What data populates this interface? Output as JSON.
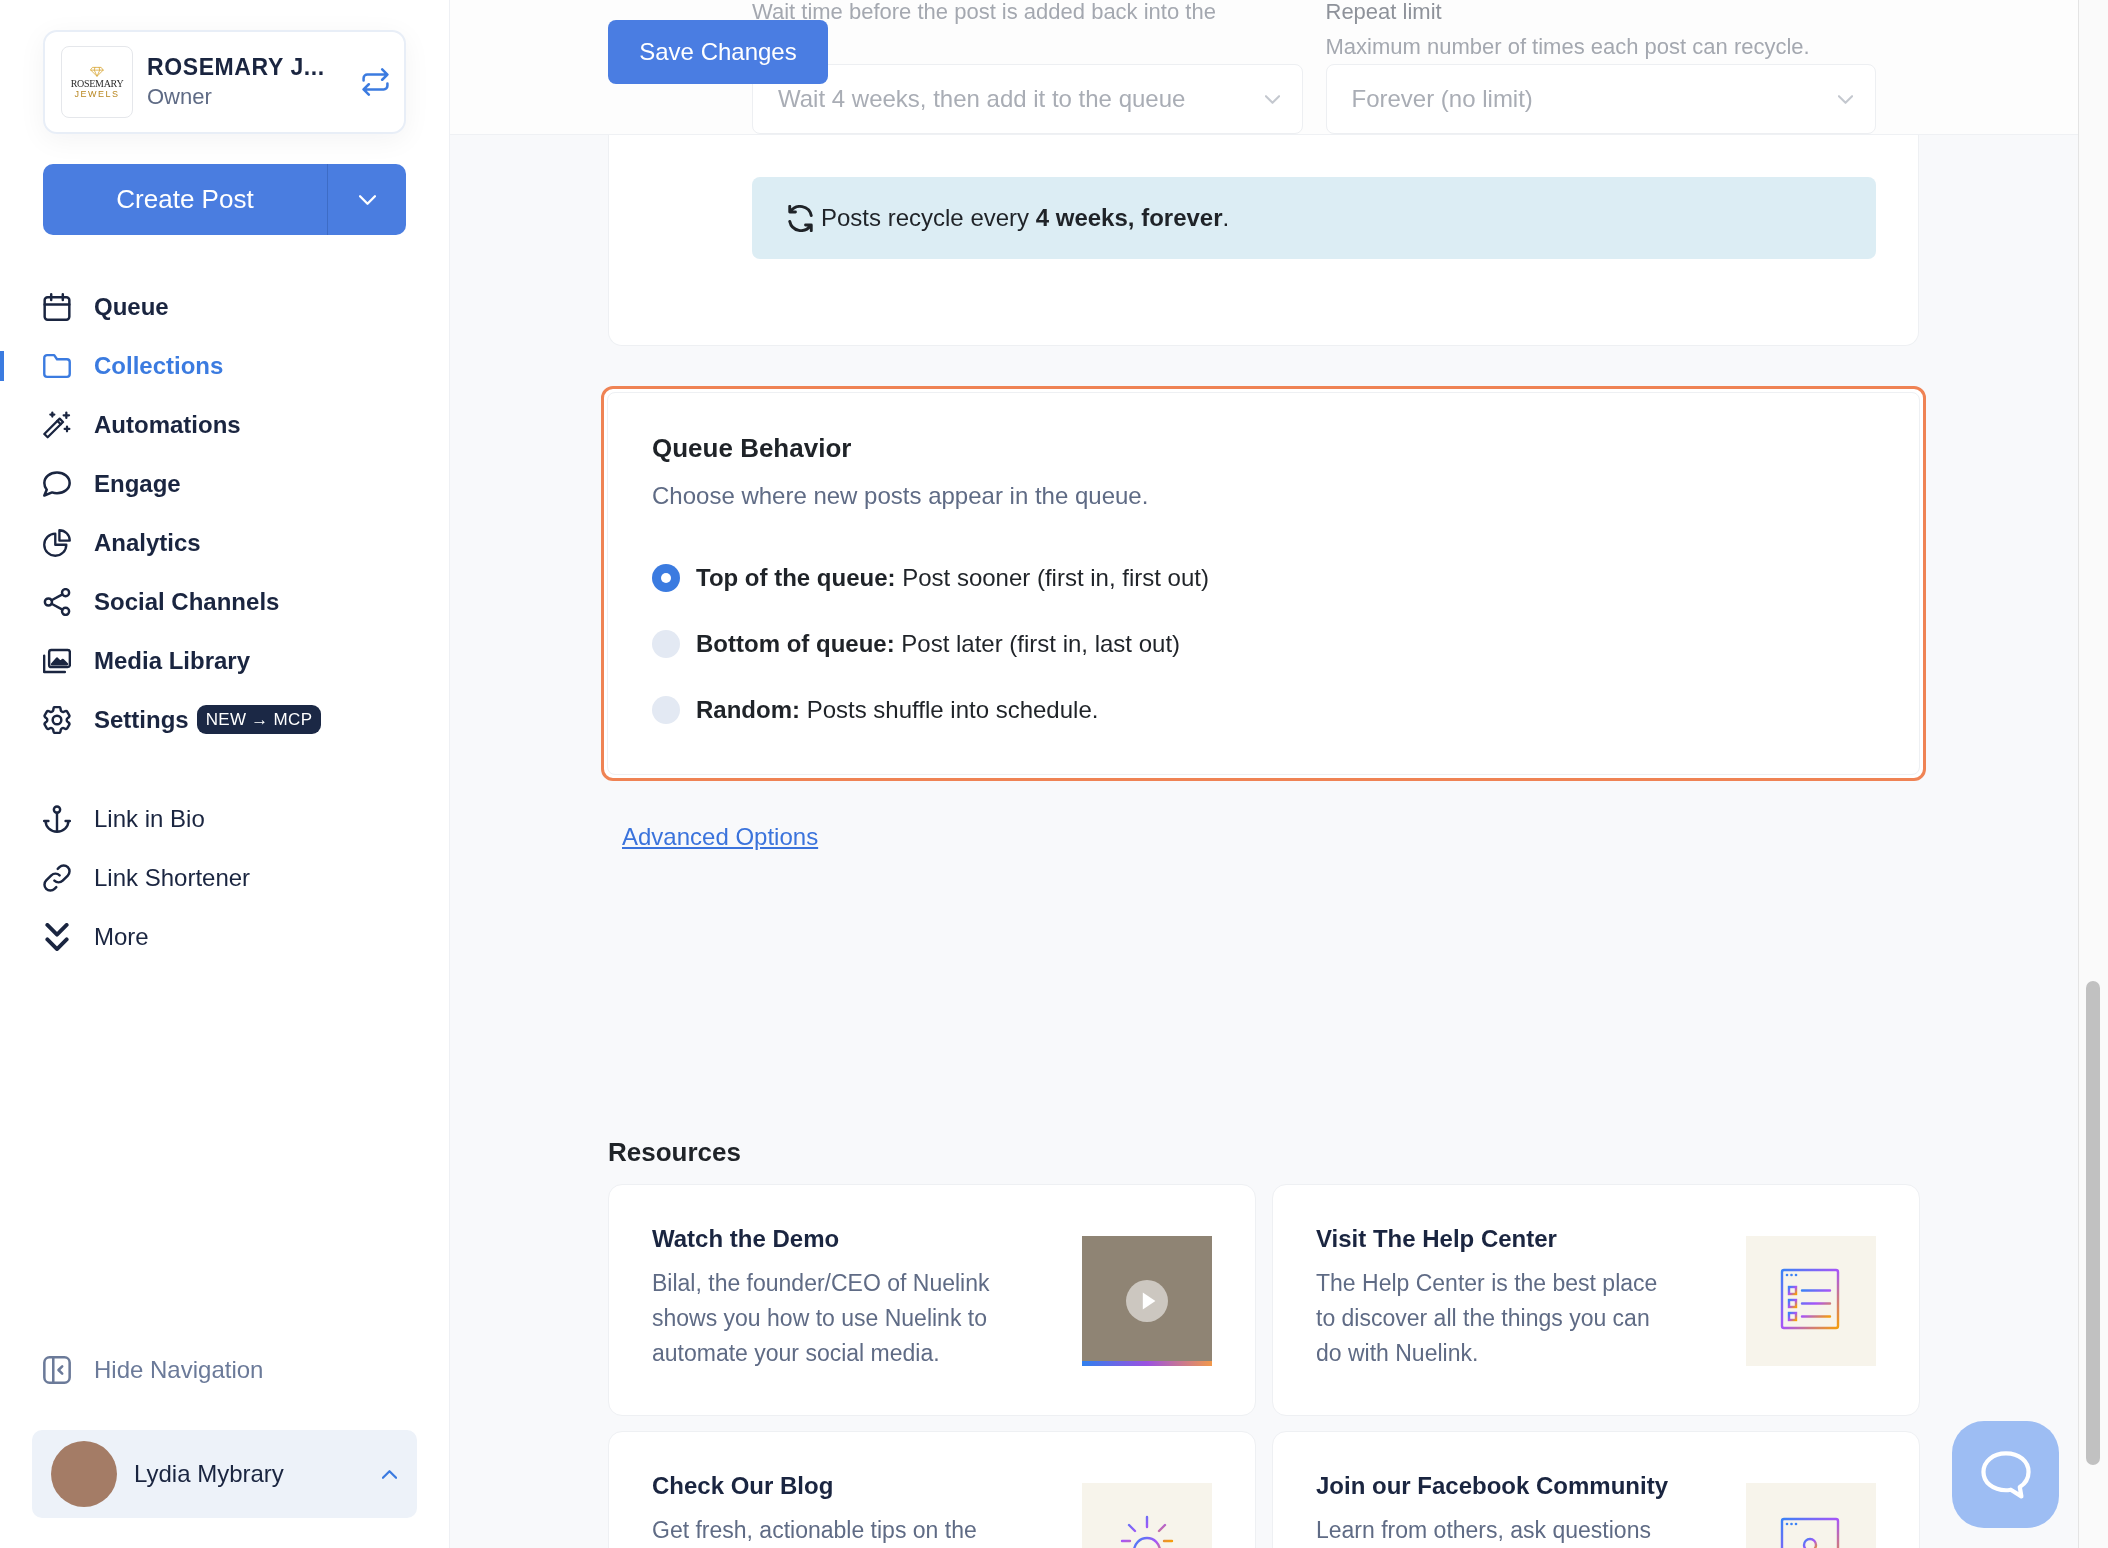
{
  "sidebar": {
    "account": {
      "logo_name": "ROSEMARY",
      "logo_tagline": "JEWELS",
      "name": "ROSEMARY J...",
      "role": "Owner"
    },
    "create_post": "Create Post",
    "nav": [
      {
        "label": "Queue",
        "selected": false
      },
      {
        "label": "Collections",
        "selected": true
      },
      {
        "label": "Automations",
        "selected": false
      },
      {
        "label": "Engage",
        "selected": false
      },
      {
        "label": "Analytics",
        "selected": false
      },
      {
        "label": "Social Channels",
        "selected": false
      },
      {
        "label": "Media Library",
        "selected": false
      },
      {
        "label": "Settings",
        "selected": false,
        "badge": "NEW → MCP"
      }
    ],
    "tools": [
      {
        "label": "Link in Bio",
        "selected": false
      },
      {
        "label": "Link Shortener",
        "selected": false
      },
      {
        "label": "More",
        "selected": false
      }
    ],
    "hide_navigation": "Hide Navigation",
    "user": {
      "name": "Lydia Mybrary"
    }
  },
  "header": {
    "save_button": "Save Changes"
  },
  "recycle_settings": {
    "fields": [
      {
        "hint": "Wait time before the post is added back into the",
        "value": "Wait 4 weeks, then add it to the queue"
      },
      {
        "label": "Repeat limit",
        "hint": "Maximum number of times each post can recycle.",
        "value": "Forever (no limit)"
      }
    ],
    "summary": "Posts recycle every **4 weeks, forever**."
  },
  "queue_behavior": {
    "title": "Queue Behavior",
    "subtitle": "Choose where new posts appear in the queue.",
    "options": [
      {
        "text": "**Top of the queue:** Post sooner (first in, first out)",
        "selected": true
      },
      {
        "text": "**Bottom of queue:** Post later (first in, last out)",
        "selected": false
      },
      {
        "text": "**Random:** Posts shuffle into schedule.",
        "selected": false
      }
    ]
  },
  "advanced_options": "Advanced Options",
  "resources": {
    "title": "Resources",
    "cards": [
      {
        "kind": "video",
        "title": "Watch the Demo",
        "description": "Bilal, the founder/CEO of Nuelink shows you how to use Nuelink to automate your social media."
      },
      {
        "kind": "checklist",
        "title": "Visit The Help Center",
        "description": "The Help Center is the best place to discover all the things you can do with Nuelink."
      },
      {
        "kind": "idea",
        "title": "Check Our Blog",
        "description": "Get fresh, actionable tips on the"
      },
      {
        "kind": "browser",
        "title": "Join our Facebook Community",
        "description": "Learn from others, ask questions"
      }
    ]
  }
}
